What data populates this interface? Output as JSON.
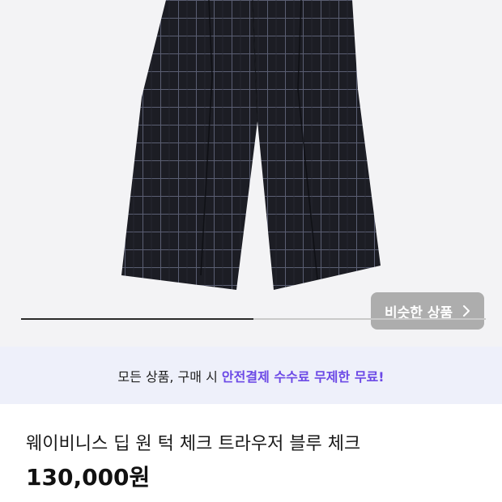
{
  "gallery": {
    "similar_button_label": "비슷한 상품",
    "progress": 0.5,
    "icons": {
      "chevron": "chevron-right-icon"
    }
  },
  "promo": {
    "prefix": "모든 상품, 구매 시 ",
    "highlight": "안전결제 수수료 무제한 무료!",
    "highlight_color": "#6b48e6"
  },
  "product": {
    "title": "웨이비니스 딥 원 턱 체크 트라우저 블루 체크",
    "price": "130,000원"
  }
}
